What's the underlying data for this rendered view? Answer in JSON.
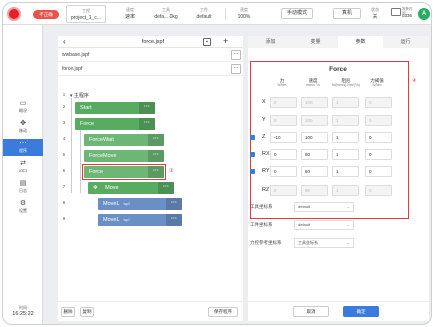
{
  "topbar": {
    "pill_label": "不正确",
    "project": {
      "caption": "工程",
      "value": "project_1_c..."
    },
    "speed": {
      "caption": "速度",
      "value": "速率"
    },
    "tool": {
      "caption": "工具",
      "value": "defa... 0kg"
    },
    "workpiece": {
      "caption": "工件",
      "value": "default"
    },
    "speed_pct": {
      "caption": "速度",
      "value": "100%"
    },
    "mode_button": "手动模式",
    "robot_button": "真机",
    "state": {
      "caption": "状态",
      "value": "关"
    },
    "alarm": {
      "caption": "报警时间",
      "count": "0336"
    },
    "avatar": "A"
  },
  "sidebar": {
    "items": [
      {
        "label": "概况",
        "icon": "monitor-icon"
      },
      {
        "label": "移动",
        "icon": "move-icon"
      },
      {
        "label": "程序",
        "icon": "program-icon"
      },
      {
        "label": "IO口",
        "icon": "io-icon"
      },
      {
        "label": "日志",
        "icon": "log-icon"
      },
      {
        "label": "设置",
        "icon": "settings-icon"
      }
    ],
    "active_index": 2,
    "time_caption": "时间",
    "time_value": "16:25:22"
  },
  "program": {
    "file_name": "force.jspf",
    "files": [
      "wwbase.jspf",
      "force.jspf"
    ],
    "tree_root": "主程序",
    "blocks": [
      {
        "line": "2",
        "label": "Start"
      },
      {
        "line": "3",
        "label": "Force"
      },
      {
        "line": "4",
        "label": "ForceWait"
      },
      {
        "line": "5",
        "label": "ForceMove"
      },
      {
        "line": "6",
        "label": "Force"
      },
      {
        "line": "7",
        "label": "Move"
      },
      {
        "line": "8",
        "label": "MoveL",
        "sub": "wp0"
      },
      {
        "line": "9",
        "label": "MoveL",
        "sub": "wp1"
      }
    ],
    "callout": "③",
    "footer": {
      "delete": "删除",
      "copy": "复制",
      "save": "保存程序"
    }
  },
  "panel": {
    "tabs": [
      "添加",
      "变量",
      "参数",
      "运行"
    ],
    "active_tab": 2,
    "title": "Force",
    "callout": "④",
    "columns": [
      {
        "name": "力",
        "unit": "N/Nm"
      },
      {
        "name": "速度",
        "unit": "mm/s °/s"
      },
      {
        "name": "阻尼",
        "unit": "N/(mm/s) Nm/(°/s)"
      },
      {
        "name": "力阈值",
        "unit": "N/Nm"
      }
    ],
    "rows": [
      {
        "axis": "X",
        "checked": false,
        "values": [
          "0",
          "100",
          "1",
          "0"
        ]
      },
      {
        "axis": "Y",
        "checked": false,
        "values": [
          "0",
          "100",
          "1",
          "0"
        ]
      },
      {
        "axis": "Z",
        "checked": true,
        "values": [
          "-10",
          "100",
          "1",
          "0"
        ]
      },
      {
        "axis": "RX",
        "checked": true,
        "values": [
          "0",
          "60",
          "1",
          "0"
        ]
      },
      {
        "axis": "RY",
        "checked": true,
        "values": [
          "0",
          "60",
          "1",
          "0"
        ]
      },
      {
        "axis": "RZ",
        "checked": false,
        "values": [
          "0",
          "60",
          "1",
          "0"
        ]
      }
    ],
    "selects": [
      {
        "label": "工具坐标系",
        "value": "default"
      },
      {
        "label": "工件坐标系",
        "value": "default"
      },
      {
        "label": "力控参考坐标系",
        "value": "工具坐标系"
      }
    ],
    "cancel": "取消",
    "confirm": "确定"
  }
}
